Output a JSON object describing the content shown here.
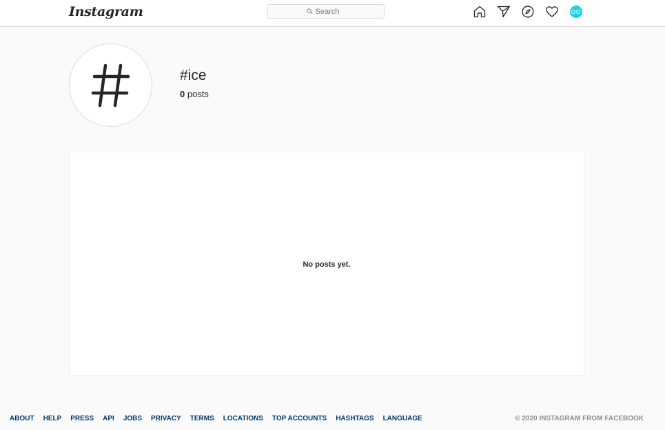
{
  "header": {
    "logo_text": "Instagram",
    "search_placeholder": "Search",
    "icons": [
      "home-icon",
      "direct-icon",
      "explore-icon",
      "activity-icon",
      "profile-avatar"
    ]
  },
  "hashtag": {
    "name": "#ice",
    "post_count": "0",
    "posts_label": "posts"
  },
  "posts": {
    "empty_message": "No posts yet."
  },
  "footer": {
    "links": [
      "ABOUT",
      "HELP",
      "PRESS",
      "API",
      "JOBS",
      "PRIVACY",
      "TERMS",
      "LOCATIONS",
      "TOP ACCOUNTS",
      "HASHTAGS",
      "LANGUAGE"
    ],
    "copyright": "© 2020 INSTAGRAM FROM FACEBOOK"
  },
  "colors": {
    "background": "#fafafa",
    "border": "#dbdbdb",
    "link": "#00376b",
    "avatar": "#1ad3e0"
  }
}
